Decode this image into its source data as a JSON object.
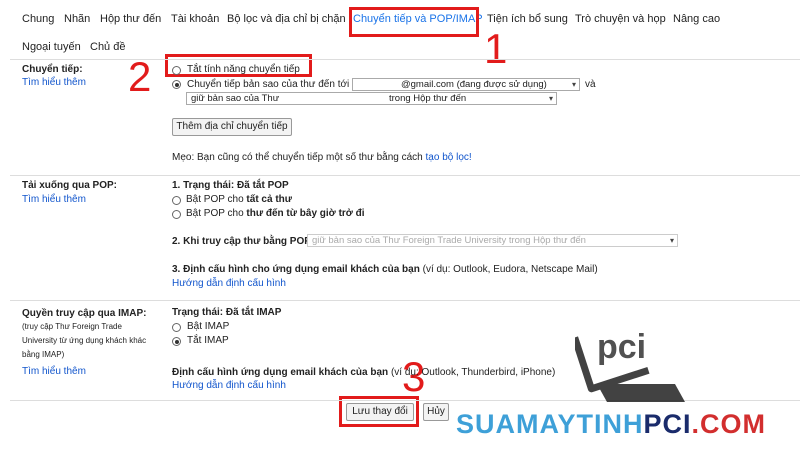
{
  "tabs": [
    {
      "label": "Chung"
    },
    {
      "label": "Nhãn"
    },
    {
      "label": "Hộp thư đến"
    },
    {
      "label": "Tài khoản"
    },
    {
      "label": "Bộ lọc và địa chỉ bị chặn"
    },
    {
      "label": "Chuyển tiếp và POP/IMAP",
      "active": true
    },
    {
      "label": "Tiện ích bổ sung"
    },
    {
      "label": "Trò chuyện và họp"
    },
    {
      "label": "Nâng cao"
    },
    {
      "label": "Ngoại tuyến"
    },
    {
      "label": "Chủ đề"
    }
  ],
  "annotations": {
    "n1": "1",
    "n2": "2",
    "n3": "3",
    "color": "#e21b1b"
  },
  "forwarding": {
    "title": "Chuyển tiếp:",
    "learn_more": "Tìm hiểu thêm",
    "option_disable": "Tắt tính năng chuyển tiếp",
    "option_forward": "Chuyển tiếp bản sao của thư đến tới",
    "address_value": "@gmail.com (đang được sử dụng)",
    "and_label": "và",
    "action_value_left": "giữ bản sao của Thư",
    "action_value_right": "trong Hộp thư đến",
    "add_button": "Thêm địa chỉ chuyển tiếp",
    "tip_text": "Mẹo: Bạn cũng có thể chuyển tiếp một số thư bằng cách",
    "tip_link": "tạo bộ lọc!"
  },
  "pop": {
    "title": "Tải xuống qua POP:",
    "learn_more": "Tìm hiểu thêm",
    "status_label": "1. Trạng thái: Đã tắt POP",
    "opt_all_prefix": "Bật POP cho",
    "opt_all_bold": "tất cả thư",
    "opt_now_prefix": "Bật POP cho",
    "opt_now_bold": "thư đến từ bây giờ trở đi",
    "access_label": "2. Khi truy cập thư bằng POP",
    "access_value": "giữ bản sao của Thư Foreign Trade University trong Hộp thư đến",
    "config_label": "3. Định cấu hình cho ứng dụng email khách của bạn",
    "config_note": "(ví dụ: Outlook, Eudora, Netscape Mail)",
    "config_link": "Hướng dẫn định cấu hình"
  },
  "imap": {
    "title": "Quyền truy cập qua IMAP:",
    "desc_1": "(truy cập Thư Foreign Trade",
    "desc_2": "University từ ứng dụng khách khác",
    "desc_3": "bằng IMAP)",
    "learn_more": "Tìm hiểu thêm",
    "status_label": "Trạng thái: Đã tắt IMAP",
    "opt_on": "Bật IMAP",
    "opt_off": "Tắt IMAP",
    "config_label": "Định cấu hình ứng dụng email khách của bạn",
    "config_note": "(ví dụ: Outlook, Thunderbird, iPhone)",
    "config_link": "Hướng dẫn định cấu hình"
  },
  "footer": {
    "save": "Lưu thay đổi",
    "cancel": "Hủy"
  },
  "watermark": {
    "part1": "SUAMAYTINH",
    "part2": "PCI",
    "part3": ".COM",
    "logo_text": "pci"
  }
}
